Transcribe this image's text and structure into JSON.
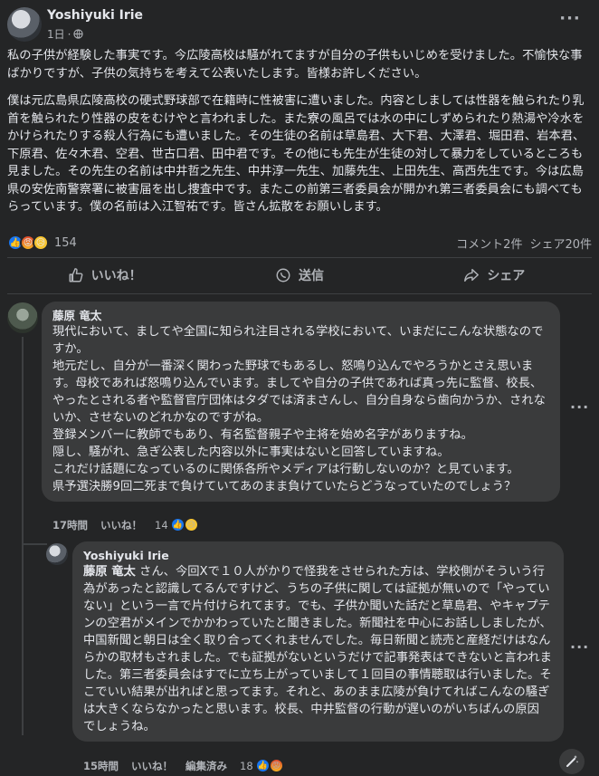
{
  "post": {
    "author": "Yoshiyuki Irie",
    "time": "1日",
    "separator": "·",
    "paragraphs": [
      "私の子供が経験した事実です。今広陵高校は騒がれてますが自分の子供もいじめを受けました。不愉快な事ばかりですが、子供の気持ちを考えて公表いたします。皆様お許しください。",
      "僕は元広島県広陵高校の硬式野球部で在籍時に性被害に遭いました。内容としましては性器を触られたり乳首を触られたり性器の皮をむけやと言われました。また寮の風呂では水の中にしずめられたり熱湯や冷水をかけられたりする殺人行為にも遭いました。その生徒の名前は草島君、大下君、大澤君、堀田君、岩本君、下原君、佐々木君、空君、世古口君、田中君です。その他にも先生が生徒の対して暴力をしているところも見ました。その先生の名前は中井哲之先生、中井淳一先生、加藤先生、上田先生、高西先生です。今は広島県の安佐南警察署に被害届を出し捜査中です。またこの前第三者委員会が開かれ第三者委員会にも調べてもらっています。僕の名前は入江智祐です。皆さん拡散をお願いします。"
    ],
    "reaction_count": "154",
    "comments_count": "コメント2件",
    "shares_count": "シェア20件",
    "actions": {
      "like": "いいね！",
      "comment": "送信",
      "share": "シェア"
    }
  },
  "comments": [
    {
      "author": "藤原 竜太",
      "text": "現代において、ましてや全国に知られ注目される学校において、いまだにこんな状態なのですか。\n地元だし、自分が一番深く関わった野球でもあるし、怒鳴り込んでやろうかとさえ思います。母校であれば怒鳴り込んでいます。ましてや自分の子供であれば真っ先に監督、校長、やったとされる者や監督官庁団体はタダでは済まさんし、自分自身なら歯向かうか、されないか、させないのどれかなのですがね。\n登録メンバーに教師でもあり、有名監督親子や主将を始め名字がありますね。\n隠し、騒がれ、急ぎ公表した内容以外に事実はないと回答していますね。\nこれだけ話題になっているのに関係各所やメディアは行動しないのか？と見ています。\n県予選決勝9回二死まで負けていてあのまま負けていたらどうなっていたのでしょう？",
      "time": "17時間",
      "like": "いいね！",
      "reactions": "14"
    },
    {
      "author": "Yoshiyuki Irie",
      "mention": "藤原 竜太",
      "text": " さん、今回Xで１０人がかりで怪我をさせられた方は、学校側がそういう行為があったと認識してるんですけど、うちの子供に関しては証拠が無いので「やっていない」という一言で片付けられてます。でも、子供か聞いた話だと草島君、やキャプテンの空君がメインでかかわっていたと聞きました。新聞社を中心にお話ししましたが、中国新聞と朝日は全く取り合ってくれませんでした。毎日新聞と読売と産経だけはなんらかの取材もされました。でも証拠がないというだけで記事発表はできないと言われました。第三者委員会はすでに立ち上がっていまして１回目の事情聴取は行いました。そこでいい結果が出ればと思ってます。それと、あのまま広陵が負けてればこんなの騒ぎは大きくならなかったと思います。校長、中井監督の行動が遅いのがいちばんの原因 でしょうね。",
      "time": "15時間",
      "like": "いいね！",
      "edited": "編集済み",
      "reactions": "18"
    }
  ],
  "colors": {
    "background": "#242526",
    "bubble": "#3a3b3c",
    "text": "#e4e6eb",
    "muted": "#b0b3b8",
    "like_blue": "#1877f2"
  },
  "icons": [
    "globe-icon",
    "more-options-icon",
    "like-icon",
    "comment-icon",
    "share-icon",
    "magic-wand-icon"
  ]
}
